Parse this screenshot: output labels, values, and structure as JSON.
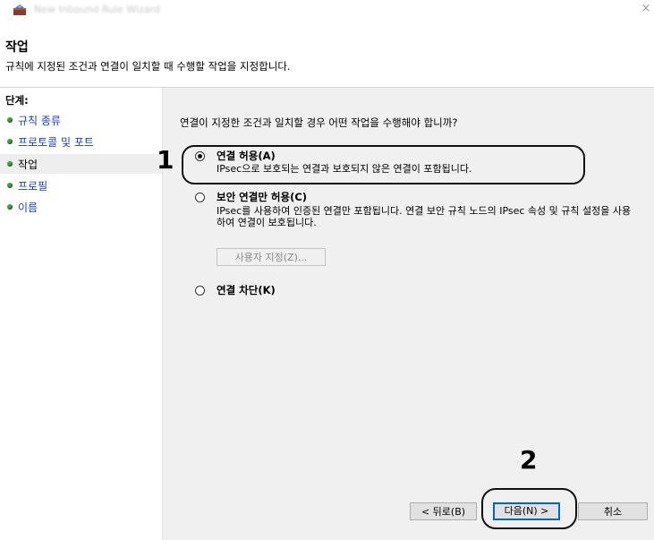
{
  "window": {
    "title": "New Inbound Rule Wizard",
    "close_label": "×"
  },
  "header": {
    "title": "작업",
    "subtitle": "규칙에 지정된 조건과 연결이 일치할 때 수행할 작업을 지정합니다."
  },
  "sidebar": {
    "heading": "단계:",
    "items": [
      {
        "label": "규칙 종류"
      },
      {
        "label": "프로토콜 및 포트"
      },
      {
        "label": "작업"
      },
      {
        "label": "프로필"
      },
      {
        "label": "이름"
      }
    ]
  },
  "main": {
    "question": "연결이 지정한 조건과 일치할 경우 어떤 작업을 수행해야 합니까?",
    "options": [
      {
        "title": "연결 허용(A)",
        "desc": "IPsec으로 보호되는 연결과 보호되지 않은 연결이 포함됩니다.",
        "selected": true
      },
      {
        "title": "보안 연결만 허용(C)",
        "desc": "IPsec를 사용하여 인증된 연결만 포함됩니다. 연결 보안 규칙 노드의 IPsec 속성 및 규칙 설정을 사용하여 연결이 보호됩니다.",
        "selected": false
      },
      {
        "title": "연결 차단(K)",
        "desc": "",
        "selected": false
      }
    ],
    "customize_button": "사용자 지정(Z)..."
  },
  "footer": {
    "back_button": "< 뒤로(B)",
    "next_button": "다음(N) >",
    "cancel_button": "취소"
  },
  "annotations": {
    "step1": "1",
    "step2": "2"
  },
  "colors": {
    "link": "#1a3fbf",
    "step_dot": "#43a047",
    "panel_bg": "#f0f0f0",
    "primary_border": "#0066cc"
  }
}
